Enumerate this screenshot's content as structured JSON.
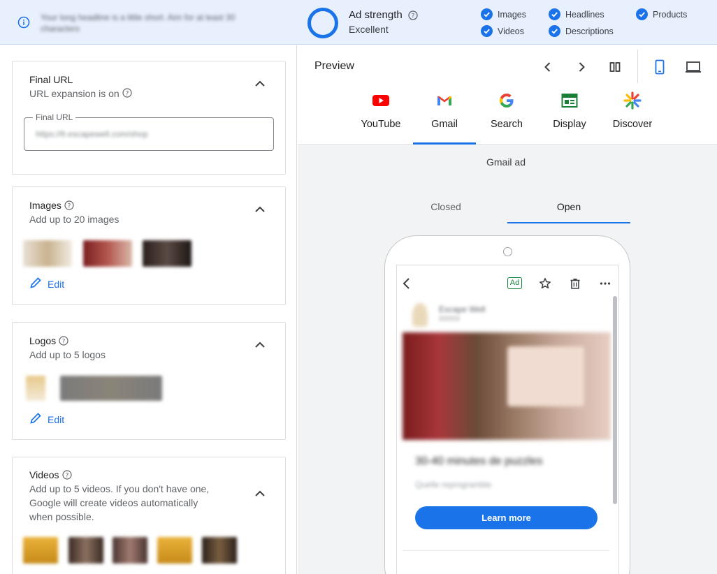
{
  "banner": {
    "tip_text": "Your long headline is a little short. Aim for at least 30 characters",
    "strength_title": "Ad strength",
    "strength_value": "Excellent",
    "checks": [
      "Images",
      "Headlines",
      "Products",
      "Videos",
      "Descriptions"
    ],
    "accent": "#1a73e8"
  },
  "final_url": {
    "title": "Final URL",
    "subtitle": "URL expansion is on",
    "field_label": "Final URL",
    "field_value": "https://fr.escapewell.com/shop"
  },
  "images": {
    "title": "Images",
    "subtitle": "Add up to 20 images",
    "edit_label": "Edit"
  },
  "logos": {
    "title": "Logos",
    "subtitle": "Add up to 5 logos",
    "edit_label": "Edit"
  },
  "videos": {
    "title": "Videos",
    "subtitle_lines": [
      "Add up to 5 videos. If you don't have one,",
      "Google will create videos automatically",
      "when possible."
    ]
  },
  "preview": {
    "title": "Preview",
    "channels": [
      {
        "label": "YouTube",
        "icon": "youtube-icon"
      },
      {
        "label": "Gmail",
        "icon": "gmail-icon"
      },
      {
        "label": "Search",
        "icon": "google-icon"
      },
      {
        "label": "Display",
        "icon": "display-icon"
      },
      {
        "label": "Discover",
        "icon": "discover-icon"
      }
    ],
    "active_channel": "Gmail",
    "ad_label": "Gmail ad",
    "tabs": [
      "Closed",
      "Open"
    ],
    "active_tab": "Open"
  },
  "mail": {
    "ad_badge": "Ad",
    "sender_name": "Escape Well",
    "headline": "30-40 minutes de puzzles",
    "subline": "Quelle reprogramble",
    "cta": "Learn more"
  }
}
